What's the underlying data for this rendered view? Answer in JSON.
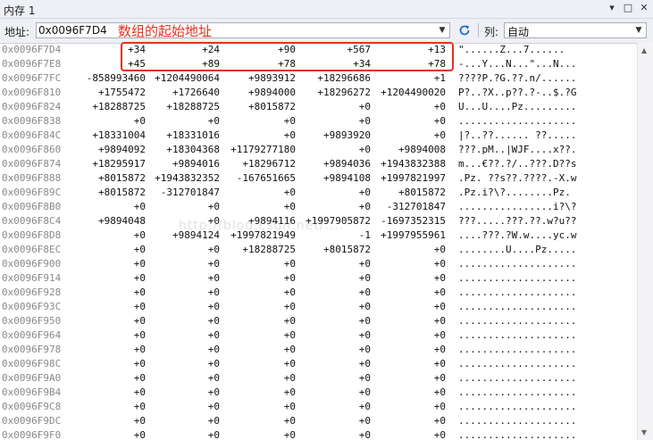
{
  "window": {
    "title": "内存 1",
    "dropdown_glyph": "▾",
    "pin_glyph": "□",
    "close_glyph": "✕"
  },
  "toolbar": {
    "address_label": "地址:",
    "address_value": "0x0096F7D4",
    "annotation": "数组的起始地址",
    "columns_label": "列:",
    "columns_value": "自动"
  },
  "watermark": "http://blog.csdn.net/....",
  "rows": [
    {
      "addr": "0x0096F7D4",
      "v": [
        "+34",
        "+24",
        "+90",
        "+567",
        "+13"
      ],
      "ascii": "\"......Z...7......"
    },
    {
      "addr": "0x0096F7E8",
      "v": [
        "+45",
        "+89",
        "+78",
        "+34",
        "+78"
      ],
      "ascii": "-...Y...N...\"...N..."
    },
    {
      "addr": "0x0096F7FC",
      "v": [
        "-858993460",
        "+1204490064",
        "+9893912",
        "+18296686",
        "+1"
      ],
      "ascii": "????P.?G.??.n/......"
    },
    {
      "addr": "0x0096F810",
      "v": [
        "+1755472",
        "+1726640",
        "+9894000",
        "+18296272",
        "+1204490020"
      ],
      "ascii": "P?..?X..p??.?-..$.?G"
    },
    {
      "addr": "0x0096F824",
      "v": [
        "+18288725",
        "+18288725",
        "+8015872",
        "+0",
        "+0"
      ],
      "ascii": "U...U....Pz........."
    },
    {
      "addr": "0x0096F838",
      "v": [
        "+0",
        "+0",
        "+0",
        "+0",
        "+0"
      ],
      "ascii": "...................."
    },
    {
      "addr": "0x0096F84C",
      "v": [
        "+18331004",
        "+18331016",
        "+0",
        "+9893920",
        "+0"
      ],
      "ascii": "|?..??...... ??....."
    },
    {
      "addr": "0x0096F860",
      "v": [
        "+9894092",
        "+18304368",
        "+1179277180",
        "+0",
        "+9894008"
      ],
      "ascii": "???.pM..|WJF....x??."
    },
    {
      "addr": "0x0096F874",
      "v": [
        "+18295917",
        "+9894016",
        "+18296712",
        "+9894036",
        "+1943832388"
      ],
      "ascii": "m...€??.?/..???.D??s"
    },
    {
      "addr": "0x0096F888",
      "v": [
        "+8015872",
        "+1943832352",
        "-167651665",
        "+9894108",
        "+1997821997"
      ],
      "ascii": ".Pz. ??s??.????.-X.w"
    },
    {
      "addr": "0x0096F89C",
      "v": [
        "+8015872",
        "-312701847",
        "+0",
        "+0",
        "+8015872"
      ],
      "ascii": ".Pz.i?\\?........Pz."
    },
    {
      "addr": "0x0096F8B0",
      "v": [
        "+0",
        "+0",
        "+0",
        "+0",
        "-312701847"
      ],
      "ascii": "................i?\\?"
    },
    {
      "addr": "0x0096F8C4",
      "v": [
        "+9894048",
        "+0",
        "+9894116",
        "+1997905872",
        "-1697352315"
      ],
      "ascii": "???.....???.??.w?u??"
    },
    {
      "addr": "0x0096F8D8",
      "v": [
        "+0",
        "+9894124",
        "+1997821949",
        "-1",
        "+1997955961"
      ],
      "ascii": "....???.?W.w....yc.w"
    },
    {
      "addr": "0x0096F8EC",
      "v": [
        "+0",
        "+0",
        "+18288725",
        "+8015872",
        "+0"
      ],
      "ascii": "........U....Pz....."
    },
    {
      "addr": "0x0096F900",
      "v": [
        "+0",
        "+0",
        "+0",
        "+0",
        "+0"
      ],
      "ascii": "...................."
    },
    {
      "addr": "0x0096F914",
      "v": [
        "+0",
        "+0",
        "+0",
        "+0",
        "+0"
      ],
      "ascii": "...................."
    },
    {
      "addr": "0x0096F928",
      "v": [
        "+0",
        "+0",
        "+0",
        "+0",
        "+0"
      ],
      "ascii": "...................."
    },
    {
      "addr": "0x0096F93C",
      "v": [
        "+0",
        "+0",
        "+0",
        "+0",
        "+0"
      ],
      "ascii": "...................."
    },
    {
      "addr": "0x0096F950",
      "v": [
        "+0",
        "+0",
        "+0",
        "+0",
        "+0"
      ],
      "ascii": "...................."
    },
    {
      "addr": "0x0096F964",
      "v": [
        "+0",
        "+0",
        "+0",
        "+0",
        "+0"
      ],
      "ascii": "...................."
    },
    {
      "addr": "0x0096F978",
      "v": [
        "+0",
        "+0",
        "+0",
        "+0",
        "+0"
      ],
      "ascii": "...................."
    },
    {
      "addr": "0x0096F98C",
      "v": [
        "+0",
        "+0",
        "+0",
        "+0",
        "+0"
      ],
      "ascii": "...................."
    },
    {
      "addr": "0x0096F9A0",
      "v": [
        "+0",
        "+0",
        "+0",
        "+0",
        "+0"
      ],
      "ascii": "...................."
    },
    {
      "addr": "0x0096F9B4",
      "v": [
        "+0",
        "+0",
        "+0",
        "+0",
        "+0"
      ],
      "ascii": "...................."
    },
    {
      "addr": "0x0096F9C8",
      "v": [
        "+0",
        "+0",
        "+0",
        "+0",
        "+0"
      ],
      "ascii": "...................."
    },
    {
      "addr": "0x0096F9DC",
      "v": [
        "+0",
        "+0",
        "+0",
        "+0",
        "+0"
      ],
      "ascii": "...................."
    },
    {
      "addr": "0x0096F9F0",
      "v": [
        "+0",
        "+0",
        "+0",
        "+0",
        "+0"
      ],
      "ascii": "...................."
    }
  ]
}
